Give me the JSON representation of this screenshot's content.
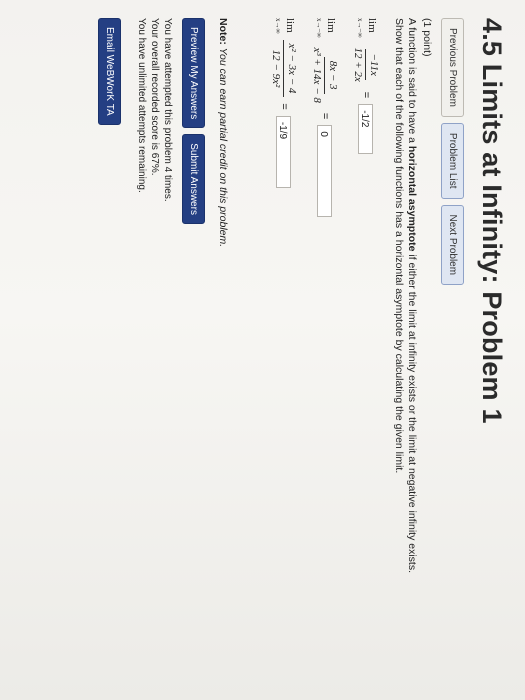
{
  "page": {
    "title": "4.5 Limits at Infinity: Problem 1"
  },
  "nav": {
    "previous": "Previous Problem",
    "list": "Problem List",
    "next": "Next Problem"
  },
  "problem": {
    "points": "(1 point)",
    "intro_a": "A function is said to have a ",
    "intro_bold": "horizontal asymptote",
    "intro_b": " if either the limit at infinity exists or the limit at negative infinity exists.",
    "instruction": "Show that each of the following functions has a horizontal asymptote by calculating the given limit.",
    "limits": [
      {
        "lim": "lim",
        "sub": "x→−∞",
        "num": "−11x",
        "den": "12 + 2x",
        "eq": "=",
        "answer": "-1/2"
      },
      {
        "lim": "lim",
        "sub": "x→−∞",
        "num": "8x − 3",
        "den": "x³ + 14x − 8",
        "eq": "=",
        "answer": "0"
      },
      {
        "lim": "lim",
        "sub": "x→∞",
        "num": "x² − 3x − 4",
        "den": "12 − 9x²",
        "eq": "=",
        "answer": "-1/9"
      }
    ]
  },
  "note": {
    "label": "Note:",
    "text": " You can earn partial credit on this problem."
  },
  "actions": {
    "preview": "Preview My Answers",
    "submit": "Submit Answers"
  },
  "status": {
    "line1": "You have attempted this problem 4 times.",
    "line2": "Your overall recorded score is 67%.",
    "line3": "You have unlimited attempts remaining."
  },
  "email": "Email WeBWorK TA"
}
